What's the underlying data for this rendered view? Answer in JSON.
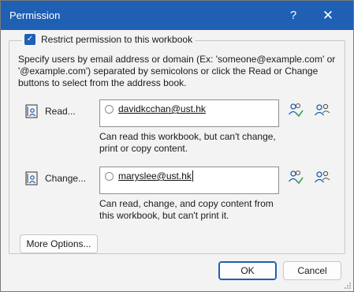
{
  "dialog": {
    "title": "Permission",
    "help_glyph": "?",
    "close_glyph": "✕"
  },
  "restrict": {
    "checked": true,
    "label": "Restrict permission to this workbook"
  },
  "instructions": "Specify users by email address or domain (Ex: 'someone@example.com' or '@example.com') separated by semicolons or click the Read or Change buttons to select from the address book.",
  "read": {
    "label": "Read...",
    "users": [
      "davidkcchan@ust.hk"
    ],
    "description": "Can read this workbook, but can't change, print or copy content."
  },
  "change": {
    "label": "Change...",
    "users": [
      "maryslee@ust.hk"
    ],
    "description": "Can read, change, and copy content from this workbook, but can't print it."
  },
  "buttons": {
    "more_options": "More Options...",
    "ok": "OK",
    "cancel": "Cancel"
  },
  "colors": {
    "title_bar": "#1f5fb4",
    "accent": "#1f5fb4",
    "check_green": "#3a9f55"
  },
  "icons": {
    "read_button": "address-book-icon",
    "check_names": "check-names-icon",
    "address_book": "people-icon"
  }
}
